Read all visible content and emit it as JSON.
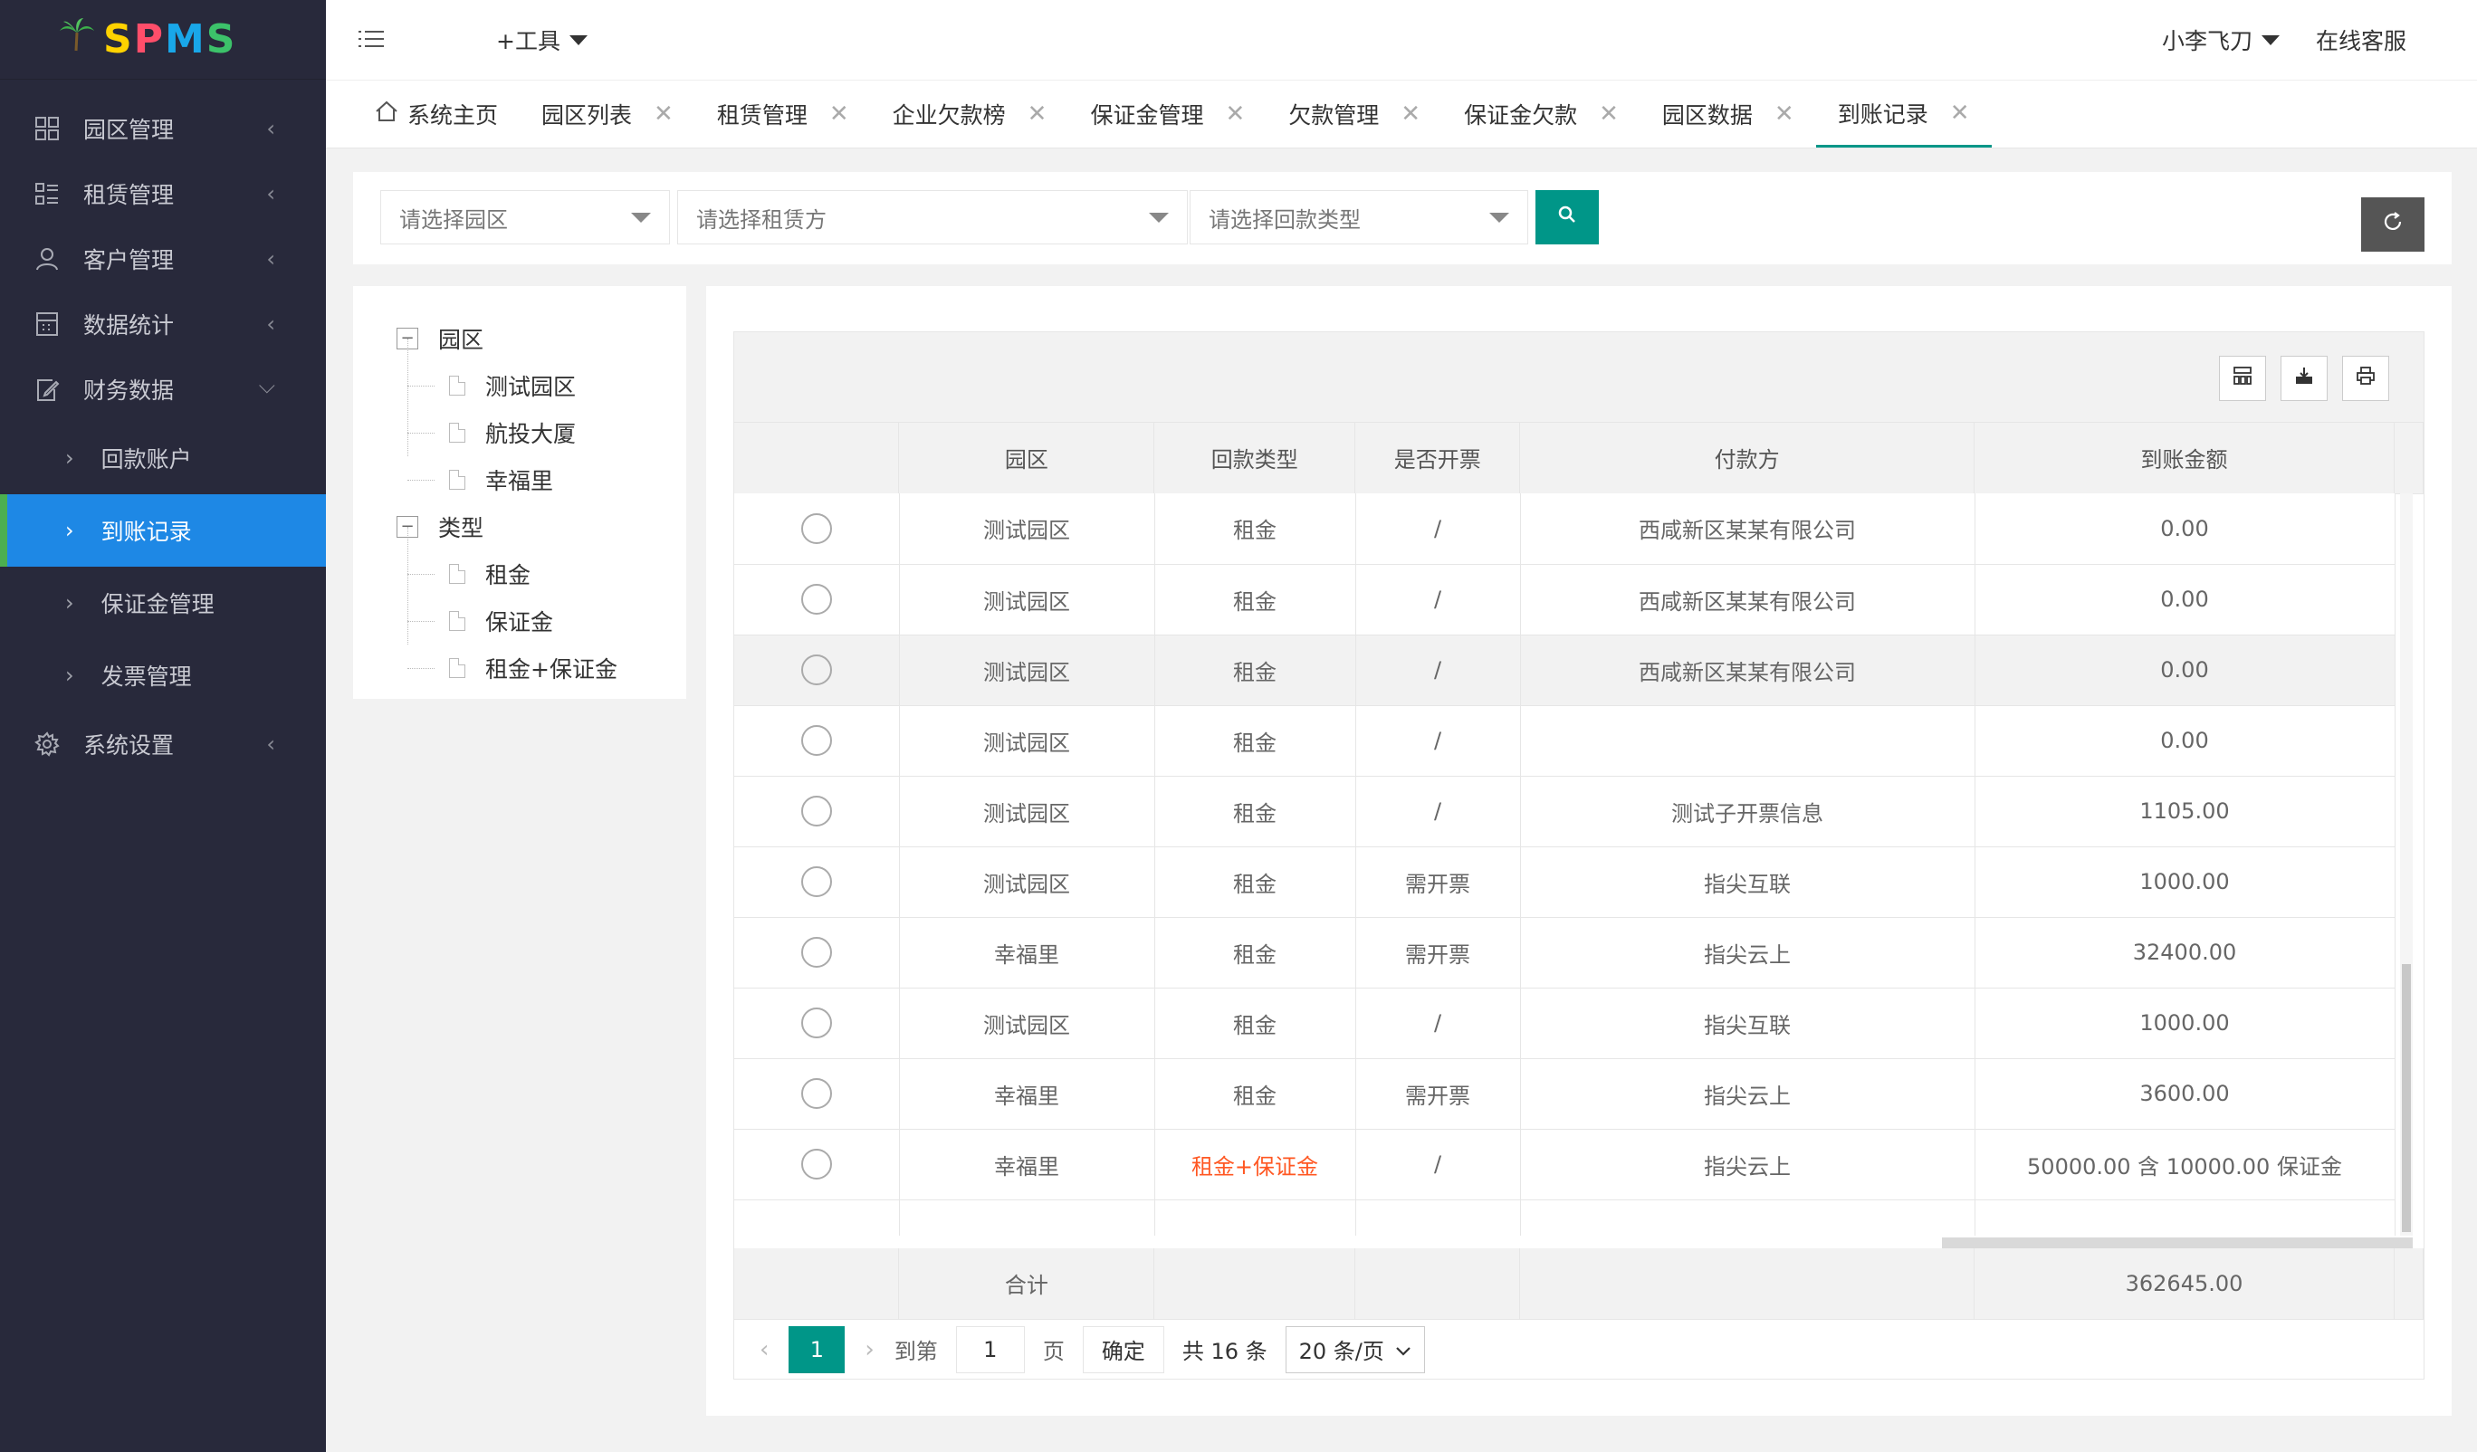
{
  "app": {
    "logo_text": "SPMS"
  },
  "sidebar": {
    "items": [
      {
        "label": "园区管理"
      },
      {
        "label": "租赁管理"
      },
      {
        "label": "客户管理"
      },
      {
        "label": "数据统计"
      },
      {
        "label": "财务数据"
      }
    ],
    "sub_items": [
      {
        "label": "回款账户"
      },
      {
        "label": "到账记录"
      },
      {
        "label": "保证金管理"
      },
      {
        "label": "发票管理"
      }
    ],
    "settings": {
      "label": "系统设置"
    }
  },
  "header": {
    "tools_label": "+工具",
    "user_name": "小李飞刀",
    "support_label": "在线客服"
  },
  "tabs": [
    {
      "label": "系统主页"
    },
    {
      "label": "园区列表"
    },
    {
      "label": "租赁管理"
    },
    {
      "label": "企业欠款榜"
    },
    {
      "label": "保证金管理"
    },
    {
      "label": "欠款管理"
    },
    {
      "label": "保证金欠款"
    },
    {
      "label": "园区数据"
    },
    {
      "label": "到账记录"
    }
  ],
  "filters": {
    "park_placeholder": "请选择园区",
    "lessor_placeholder": "请选择租赁方",
    "type_placeholder": "请选择回款类型"
  },
  "tree": {
    "park": {
      "label": "园区",
      "children": [
        "测试园区",
        "航投大厦",
        "幸福里"
      ]
    },
    "type": {
      "label": "类型",
      "children": [
        "租金",
        "保证金",
        "租金+保证金"
      ]
    }
  },
  "table": {
    "columns": [
      "园区",
      "回款类型",
      "是否开票",
      "付款方",
      "到账金额"
    ],
    "rows": [
      {
        "park": "测试园区",
        "type": "租金",
        "invoice": "/",
        "payer": "西咸新区某某有限公司",
        "amount": "0.00"
      },
      {
        "park": "测试园区",
        "type": "租金",
        "invoice": "/",
        "payer": "西咸新区某某有限公司",
        "amount": "0.00"
      },
      {
        "park": "测试园区",
        "type": "租金",
        "invoice": "/",
        "payer": "西咸新区某某有限公司",
        "amount": "0.00"
      },
      {
        "park": "测试园区",
        "type": "租金",
        "invoice": "/",
        "payer": "",
        "amount": "0.00"
      },
      {
        "park": "测试园区",
        "type": "租金",
        "invoice": "/",
        "payer": "测试子开票信息",
        "amount": "1105.00"
      },
      {
        "park": "测试园区",
        "type": "租金",
        "invoice": "需开票",
        "payer": "指尖互联",
        "amount": "1000.00"
      },
      {
        "park": "幸福里",
        "type": "租金",
        "invoice": "需开票",
        "payer": "指尖云上",
        "amount": "32400.00"
      },
      {
        "park": "测试园区",
        "type": "租金",
        "invoice": "/",
        "payer": "指尖互联",
        "amount": "1000.00"
      },
      {
        "park": "幸福里",
        "type": "租金",
        "invoice": "需开票",
        "payer": "指尖云上",
        "amount": "3600.00"
      },
      {
        "park": "幸福里",
        "type": "租金+保证金",
        "invoice": "/",
        "payer": "指尖云上",
        "amount": "50000.00 含 10000.00 保证金"
      }
    ],
    "total_label": "合计",
    "total_amount": "362645.00"
  },
  "pager": {
    "current_page": "1",
    "goto_label": "到第",
    "goto_value": "1",
    "page_unit": "页",
    "confirm_label": "确定",
    "total_text": "共 16 条",
    "page_size": "20 条/页"
  },
  "colors": {
    "accent": "#009688",
    "sidebar_bg": "#28293b",
    "active_nav": "#1e88e5",
    "warn": "#ff5722"
  }
}
